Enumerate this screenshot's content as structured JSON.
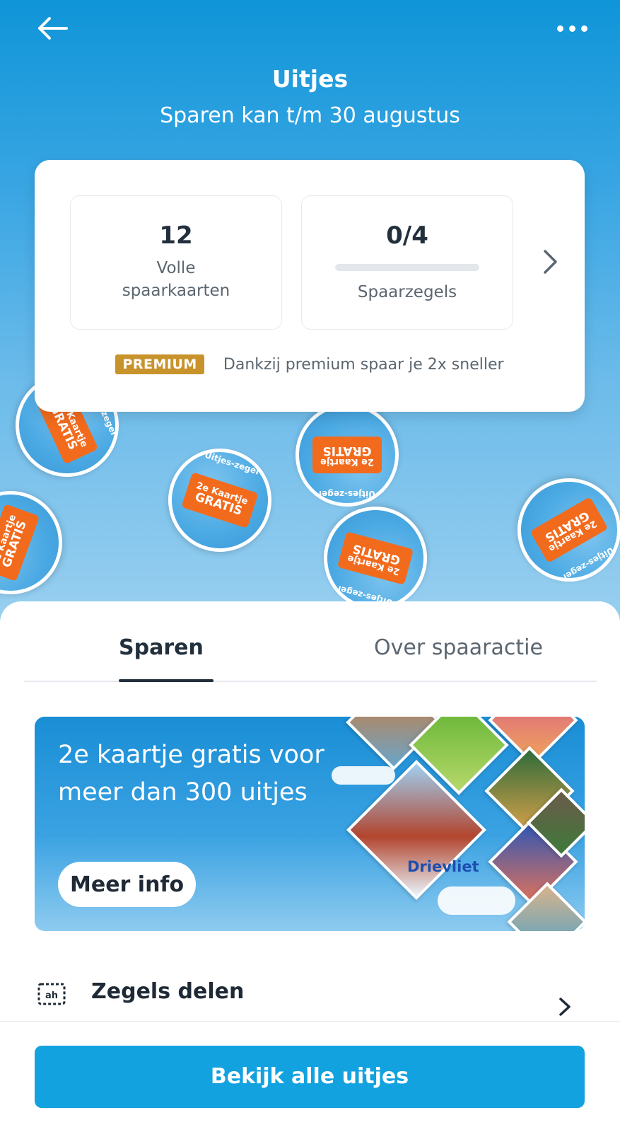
{
  "header": {
    "title": "Uitjes",
    "subtitle": "Sparen kan t/m 30 augustus",
    "back_icon": "arrow-left-icon",
    "more_icon": "more-horizontal-icon"
  },
  "stats": {
    "full_cards": {
      "value": "12",
      "label_line1": "Volle",
      "label_line2": "spaarkaarten"
    },
    "stamps": {
      "value": "0/4",
      "label": "Spaarzegels",
      "progress": 0
    }
  },
  "premium": {
    "badge": "PREMIUM",
    "text": "Dankzij premium spaar je 2x sneller"
  },
  "zegel": {
    "arc_text": "Uitjes-zegel",
    "ticket_line1": "2e Kaartje",
    "ticket_line2": "GRATIS"
  },
  "tabs": [
    {
      "label": "Sparen",
      "active": true
    },
    {
      "label": "Over spaaractie",
      "active": false
    }
  ],
  "banner": {
    "title": "2e kaartje gratis voor meer dan 300 uitjes",
    "button_label": "Meer info",
    "park_label": "Drievliet"
  },
  "share": {
    "label": "Zegels delen",
    "icon": "ah-card-icon"
  },
  "cta": {
    "label": "Bekijk alle uitjes"
  },
  "colors": {
    "primary": "#12a2e0",
    "premium": "#c9932c",
    "ticket": "#f26b1d",
    "text_dark": "#1f2a36"
  }
}
